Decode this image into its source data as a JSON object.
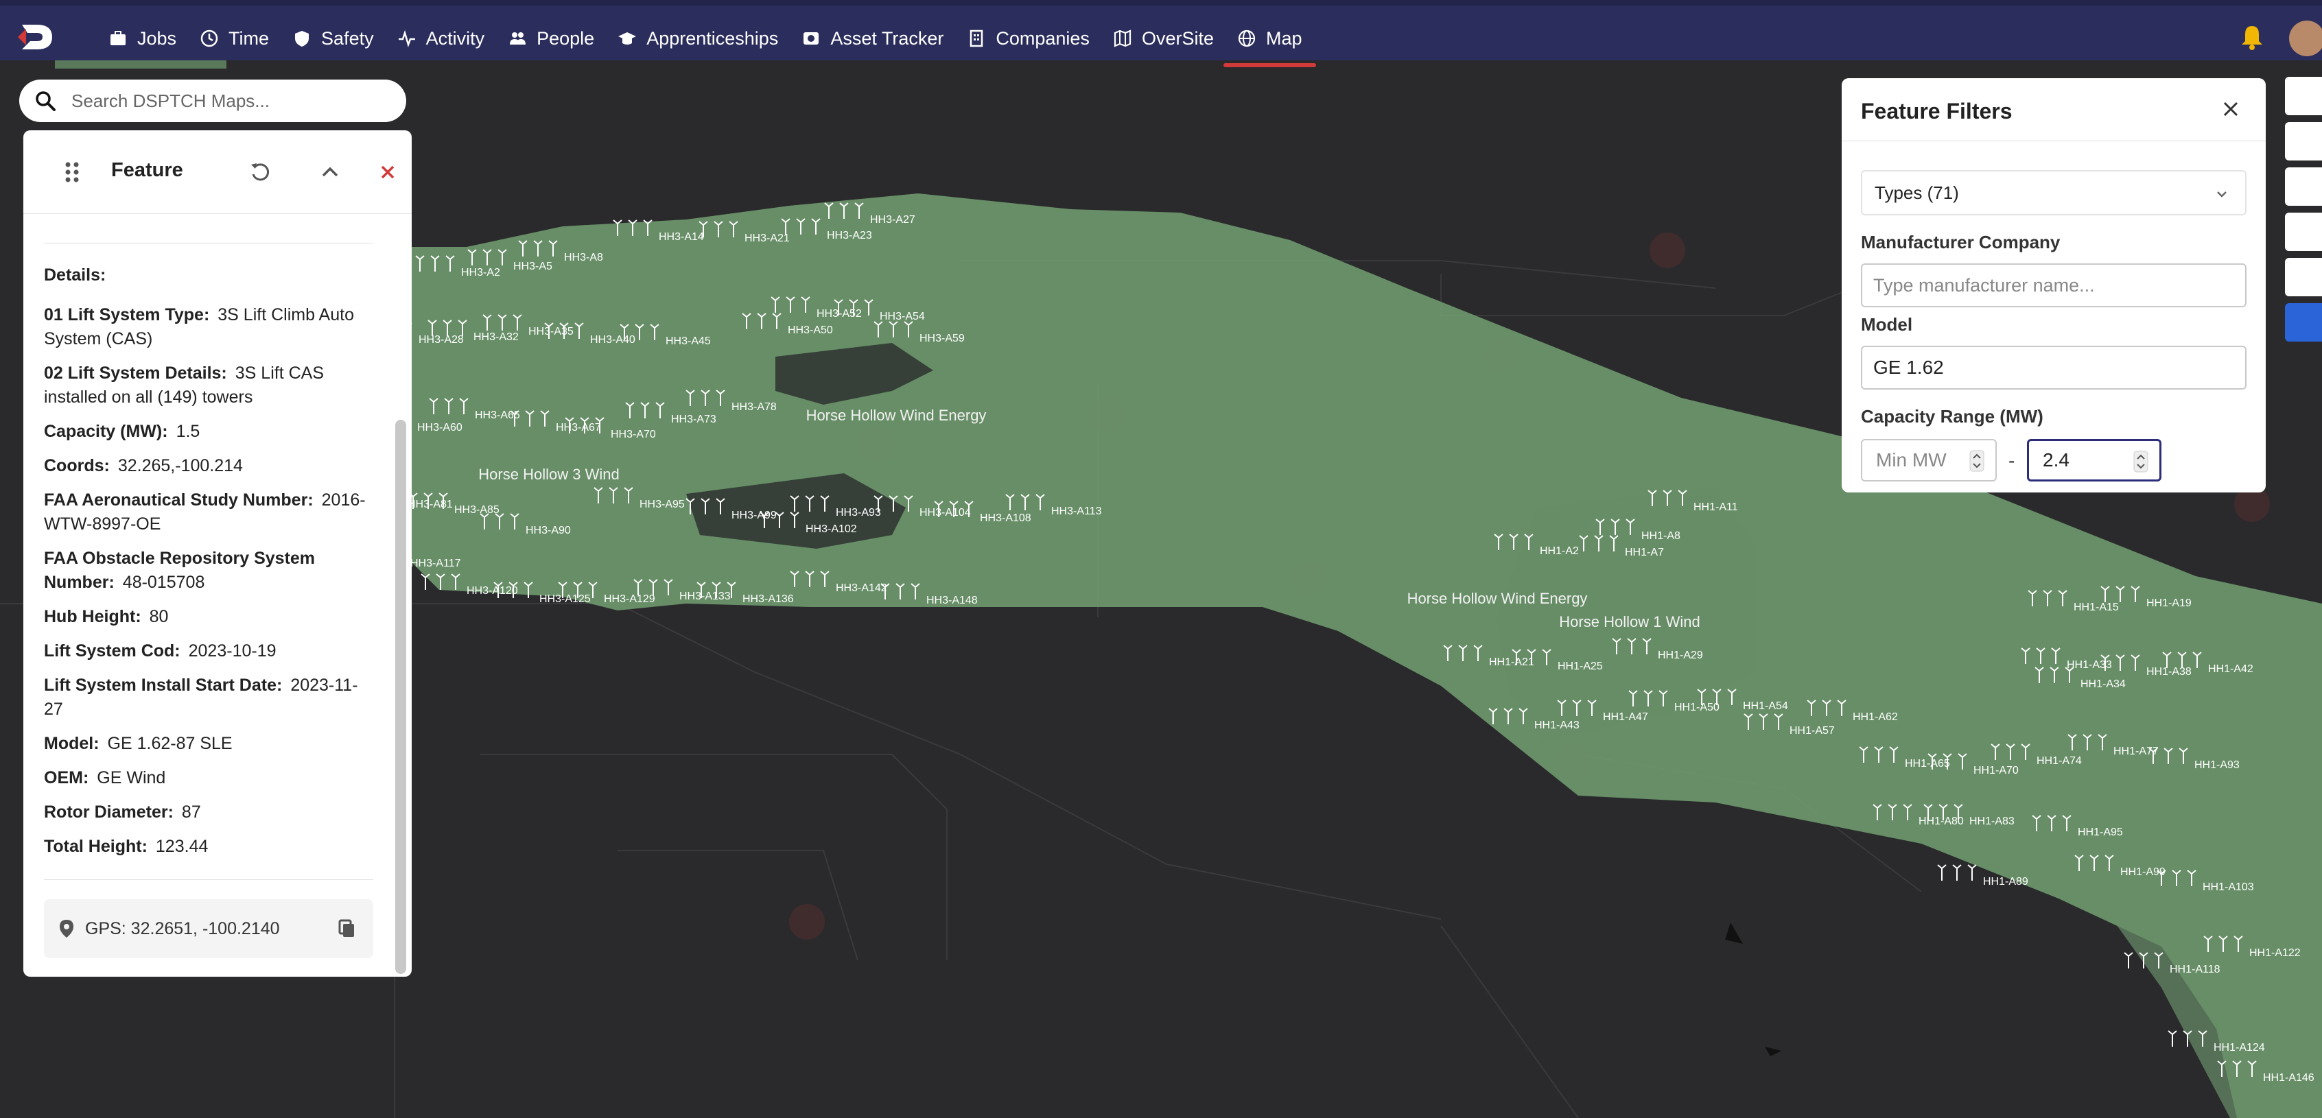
{
  "nav": {
    "items": [
      {
        "label": "Jobs",
        "icon": "briefcase-icon"
      },
      {
        "label": "Time",
        "icon": "clock-icon"
      },
      {
        "label": "Safety",
        "icon": "shield-icon"
      },
      {
        "label": "Activity",
        "icon": "activity-icon"
      },
      {
        "label": "People",
        "icon": "people-icon"
      },
      {
        "label": "Apprenticeships",
        "icon": "graduation-cap-icon"
      },
      {
        "label": "Asset Tracker",
        "icon": "camera-icon"
      },
      {
        "label": "Companies",
        "icon": "building-icon"
      },
      {
        "label": "OverSite",
        "icon": "map-fold-icon"
      },
      {
        "label": "Map",
        "icon": "globe-icon",
        "active": true
      }
    ]
  },
  "search": {
    "placeholder": "Search DSPTCH Maps..."
  },
  "feature": {
    "title": "Feature",
    "details_label": "Details:",
    "rows": [
      {
        "key": "01 Lift System Type:",
        "value": "3S Lift Climb Auto System (CAS)"
      },
      {
        "key": "02 Lift System Details:",
        "value": "3S Lift CAS installed on all (149) towers"
      },
      {
        "key": "Capacity (MW):",
        "value": "1.5"
      },
      {
        "key": "Coords:",
        "value": "32.265,-100.214"
      },
      {
        "key": "FAA Aeronautical Study Number:",
        "value": "2016-WTW-8997-OE"
      },
      {
        "key": "FAA Obstacle Repository System Number:",
        "value": "48-015708"
      },
      {
        "key": "Hub Height:",
        "value": "80"
      },
      {
        "key": "Lift System Cod:",
        "value": "2023-10-19"
      },
      {
        "key": "Lift System Install Start Date:",
        "value": "2023-11-27"
      },
      {
        "key": "Model:",
        "value": "GE 1.62-87 SLE"
      },
      {
        "key": "OEM:",
        "value": "GE Wind"
      },
      {
        "key": "Rotor Diameter:",
        "value": "87"
      },
      {
        "key": "Total Height:",
        "value": "123.44"
      }
    ],
    "gps": "GPS: 32.2651, -100.2140"
  },
  "filters": {
    "title": "Feature Filters",
    "types": "Types (71)",
    "manufacturer_label": "Manufacturer Company",
    "manufacturer_placeholder": "Type manufacturer name...",
    "model_label": "Model",
    "model_value": "GE 1.62",
    "capacity_label": "Capacity Range (MW)",
    "capacity_min_placeholder": "Min MW",
    "capacity_max_value": "2.4",
    "dash": "-"
  },
  "map": {
    "areas": [
      "Horse Hollow Wind Energy",
      "Horse Hollow 3 Wind",
      "Horse Hollow Wind Energy",
      "Horse Hollow 1 Wind"
    ],
    "turbines_hh3": [
      "HH3-A27",
      "HH3-A14",
      "HH3-A21",
      "HH3-A23",
      "HH3-A2",
      "HH3-A5",
      "HH3-A8",
      "HH3-A52",
      "HH3-A54",
      "HH3-A50",
      "HH3-A59",
      "HH3-A28",
      "HH3-A32",
      "HH3-A35",
      "HH3-A40",
      "HH3-A45",
      "HH3-A60",
      "HH3-A65",
      "HH3-A67",
      "HH3-A70",
      "HH3-A73",
      "HH3-A78",
      "HH3-A81",
      "HH3-A85",
      "HH3-A90",
      "HH3-A95",
      "HH3-A99",
      "HH3-A93",
      "HH3-A102",
      "HH3-A104",
      "HH3-A108",
      "HH3-A113",
      "HH3-A117",
      "HH3-A120",
      "HH3-A125",
      "HH3-A129",
      "HH3-A133",
      "HH3-A136",
      "HH3-A142",
      "HH3-A148"
    ],
    "turbines_hh1": [
      "HH1-A11",
      "HH1-A8",
      "HH1-A2",
      "HH1-A7",
      "HH1-A21",
      "HH1-A25",
      "HH1-A29",
      "HH1-A43",
      "HH1-A47",
      "HH1-A50",
      "HH1-A54",
      "HH1-A57",
      "HH1-A62",
      "HH1-A15",
      "HH1-A19",
      "HH1-A33",
      "HH1-A34",
      "HH1-A38",
      "HH1-A42",
      "HH1-A65",
      "HH1-A70",
      "HH1-A74",
      "HH1-A77",
      "HH1-A93",
      "HH1-A80",
      "HH1-A83",
      "HH1-A95",
      "HH1-A89",
      "HH1-A99",
      "HH1-A103",
      "HH1-A118",
      "HH1-A122",
      "HH1-A124",
      "HH1-A146"
    ]
  },
  "colors": {
    "topbar": "#2b2d5c",
    "wind_area": "#6f9a6f",
    "map_bg": "#2a2a2c",
    "active_tab": "#d23a3a",
    "focus": "#2b2d7a"
  }
}
